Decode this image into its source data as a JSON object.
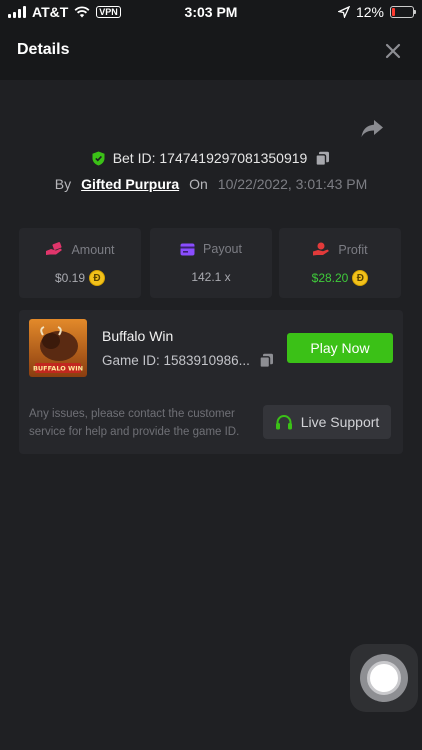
{
  "status_bar": {
    "carrier": "AT&T",
    "vpn": "VPN",
    "time": "3:03 PM",
    "battery": "12%",
    "icons": [
      "signal-icon",
      "wifi-icon",
      "location-arrow-icon",
      "battery-icon"
    ]
  },
  "header": {
    "title": "Details",
    "close_icon": "close-icon"
  },
  "bet": {
    "id_label": "Bet ID: 1747419297081350919",
    "by_label": "By",
    "user": "Gifted Purpura",
    "on_label": "On",
    "date": "10/22/2022, 3:01:43 PM"
  },
  "stats": {
    "amount": {
      "label": "Amount",
      "value": "$0.19",
      "icon": "hand-coin-icon"
    },
    "payout": {
      "label": "Payout",
      "value": "142.1 x",
      "icon": "card-icon"
    },
    "profit": {
      "label": "Profit",
      "value": "$28.20",
      "icon": "profit-hand-icon"
    },
    "coin_symbol": "Ð"
  },
  "game": {
    "name": "Buffalo Win",
    "id_label": "Game ID: 1583910986...",
    "thumb_text": "BUFFALO WIN",
    "play_label": "Play Now",
    "issue_text": "Any issues, please contact the customer service for help and provide the game ID.",
    "support_label": "Live Support"
  },
  "colors": {
    "accent_green": "#3bc117",
    "profit_green": "#3fca3a",
    "coin_gold": "#f2c11b",
    "amount_pink": "#e0356b",
    "payout_purple": "#8a4dff",
    "profit_red": "#e23a3a"
  }
}
